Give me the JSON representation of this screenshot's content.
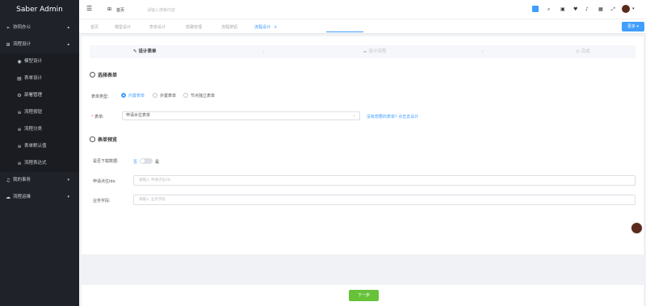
{
  "app": {
    "title": "Saber Admin"
  },
  "sidebar": {
    "items": [
      {
        "icon": "send-icon",
        "glyph": "➢",
        "label": "协同办公",
        "arrow": "▴"
      },
      {
        "icon": "grid-icon",
        "glyph": "⊞",
        "label": "流程设计",
        "arrow": "▴"
      },
      {
        "icon": "pin-icon",
        "glyph": "◉",
        "label": "模型设计",
        "sub": true
      },
      {
        "icon": "form-icon",
        "glyph": "▤",
        "label": "表单设计",
        "sub": true
      },
      {
        "icon": "gear-icon",
        "glyph": "⚙",
        "label": "部署管理",
        "sub": true
      },
      {
        "icon": "list-icon",
        "glyph": "≡",
        "label": "流程按钮",
        "sub": true
      },
      {
        "icon": "list-icon",
        "glyph": "≡",
        "label": "流程分类",
        "sub": true
      },
      {
        "icon": "list-icon",
        "glyph": "≡",
        "label": "表单默认值",
        "sub": true
      },
      {
        "icon": "list-icon",
        "glyph": "≡",
        "label": "流程表达式",
        "sub": true
      },
      {
        "icon": "bell-icon",
        "glyph": "♫",
        "label": "我的事务",
        "arrow": "▾"
      },
      {
        "icon": "cloud-icon",
        "glyph": "☁",
        "label": "流程运维",
        "arrow": "▾"
      }
    ]
  },
  "topbar": {
    "home_label": "首页",
    "search_placeholder": "请输入搜索内容"
  },
  "tabs": [
    {
      "label": "首页"
    },
    {
      "label": "模型设计"
    },
    {
      "label": "表单设计"
    },
    {
      "label": "部署管理"
    },
    {
      "label": "流程按钮"
    },
    {
      "label": "流程设计",
      "close": "×",
      "active": true
    }
  ],
  "more_label": "更多 ▾",
  "steps": [
    {
      "icon": "✎",
      "label": "设计表单",
      "active": true
    },
    {
      "icon": "☁",
      "label": "设计流程"
    },
    {
      "icon": "◎",
      "label": "完成"
    }
  ],
  "select_form": {
    "section_title": "选择表单",
    "type_label": "表单类型:",
    "radio_options": [
      "内置表单",
      "外置表单",
      "节点独立表单"
    ],
    "form_label": "表单:",
    "form_value": "申请水位表单",
    "missing_text": "没有想要的表单? 点击去设计"
  },
  "preview": {
    "section_title": "表单预览",
    "download_label": "是否下载数据:",
    "toggle_off": "否",
    "toggle_on": "是",
    "field1_label": "申请点位ids:",
    "field1_placeholder": "请输入 申请点位ids",
    "field2_label": "业务字段:",
    "field2_placeholder": "请输入 业务字段"
  },
  "next_button": "下一步",
  "colors": {
    "primary": "#409eff",
    "success": "#67c23a",
    "sidebar": "#20222a"
  }
}
